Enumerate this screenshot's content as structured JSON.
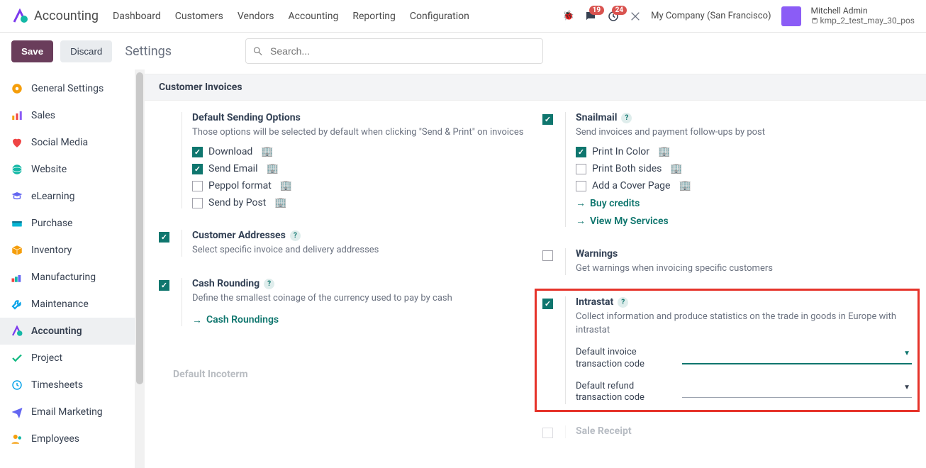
{
  "header": {
    "app": "Accounting",
    "menu": [
      "Dashboard",
      "Customers",
      "Vendors",
      "Accounting",
      "Reporting",
      "Configuration"
    ],
    "msg_badge": "19",
    "activity_badge": "24",
    "company": "My Company (San Francisco)",
    "user_name": "Mitchell Admin",
    "db_name": "kmp_2_test_may_30_pos"
  },
  "actionbar": {
    "save": "Save",
    "discard": "Discard",
    "breadcrumb": "Settings",
    "search_placeholder": "Search..."
  },
  "sidebar": {
    "items": [
      {
        "label": "General Settings"
      },
      {
        "label": "Sales"
      },
      {
        "label": "Social Media"
      },
      {
        "label": "Website"
      },
      {
        "label": "eLearning"
      },
      {
        "label": "Purchase"
      },
      {
        "label": "Inventory"
      },
      {
        "label": "Manufacturing"
      },
      {
        "label": "Maintenance"
      },
      {
        "label": "Accounting"
      },
      {
        "label": "Project"
      },
      {
        "label": "Timesheets"
      },
      {
        "label": "Email Marketing"
      },
      {
        "label": "Employees"
      }
    ]
  },
  "section_title": "Customer Invoices",
  "left": {
    "sending": {
      "title": "Default Sending Options",
      "desc": "Those options will be selected by default when clicking \"Send & Print\" on invoices",
      "opts": {
        "download": "Download",
        "email": "Send Email",
        "peppol": "Peppol format",
        "post": "Send by Post"
      }
    },
    "addresses": {
      "title": "Customer Addresses",
      "desc": "Select specific invoice and delivery addresses"
    },
    "rounding": {
      "title": "Cash Rounding",
      "desc": "Define the smallest coinage of the currency used to pay by cash",
      "link": "Cash Roundings"
    },
    "incoterm": {
      "title": "Default Incoterm"
    }
  },
  "right": {
    "snail": {
      "title": "Snailmail",
      "desc": "Send invoices and payment follow-ups by post",
      "color": "Print In Color",
      "both": "Print Both sides",
      "cover": "Add a Cover Page",
      "buy": "Buy credits",
      "view": "View My Services"
    },
    "warnings": {
      "title": "Warnings",
      "desc": "Get warnings when invoicing specific customers"
    },
    "intrastat": {
      "title": "Intrastat",
      "desc": "Collect information and produce statistics on the trade in goods in Europe with intrastat",
      "f1": "Default invoice transaction code",
      "f2": "Default refund transaction code"
    },
    "sale": {
      "title": "Sale Receipt"
    }
  }
}
